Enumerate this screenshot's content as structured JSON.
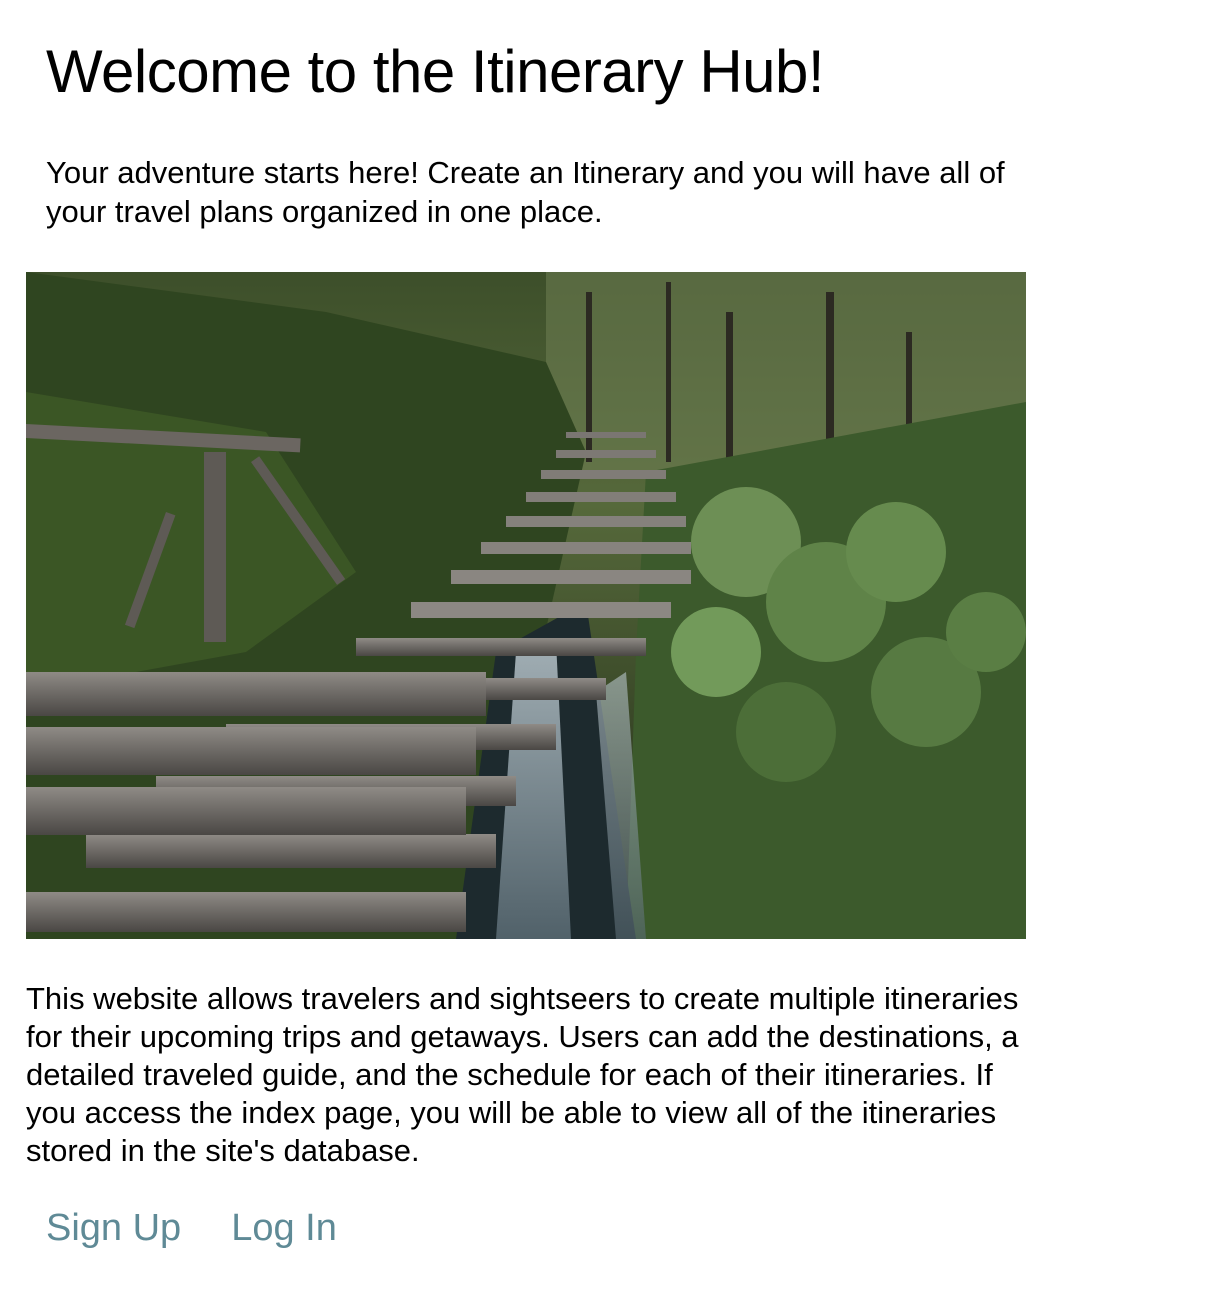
{
  "page": {
    "title": "Welcome to the Itinerary Hub!",
    "tagline": "Your adventure starts here! Create an Itinerary and you will have all of your travel plans organized in one place.",
    "description": "This website allows travelers and sightseers to create multiple itineraries for their upcoming trips and getaways. Users can add the destinations, a detailed traveled guide, and the schedule for each of their itineraries. If you access the index page, you will be able to view all of the itineraries stored in the site's database."
  },
  "auth": {
    "sign_up_label": "Sign Up",
    "log_in_label": "Log In"
  },
  "colors": {
    "link": "#5f8a96",
    "text": "#000000",
    "background": "#ffffff"
  }
}
